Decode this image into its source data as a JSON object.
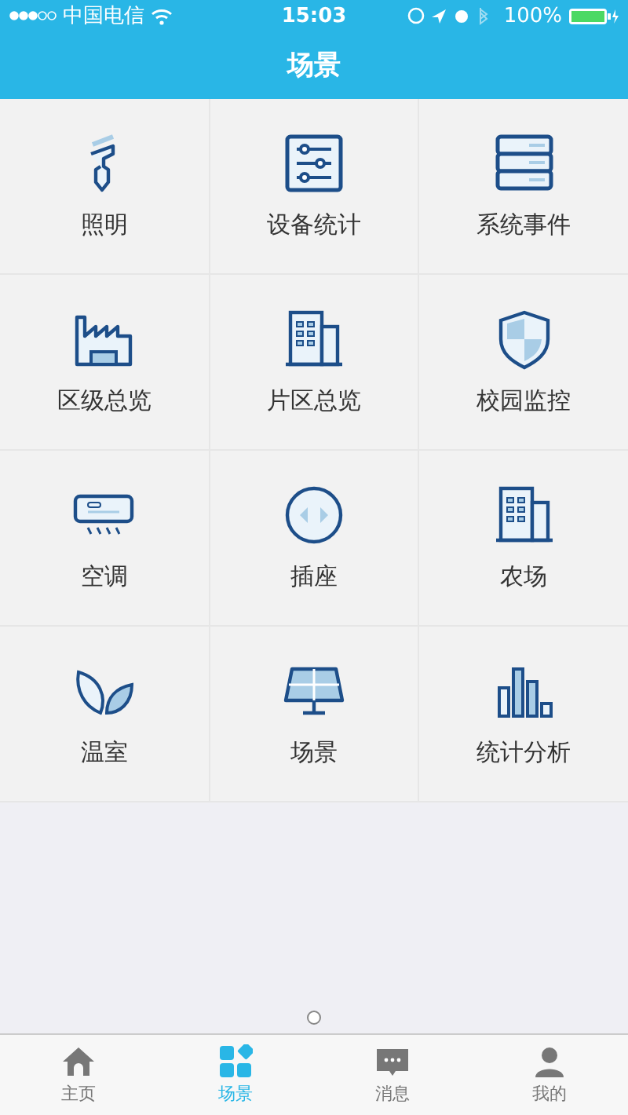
{
  "status_bar": {
    "carrier": "中国电信",
    "time": "15:03",
    "battery": "100%"
  },
  "header": {
    "title": "场景"
  },
  "grid": [
    {
      "label": "照明",
      "kind": "bulb"
    },
    {
      "label": "设备统计",
      "kind": "sliders"
    },
    {
      "label": "系统事件",
      "kind": "server"
    },
    {
      "label": "区级总览",
      "kind": "factory"
    },
    {
      "label": "片区总览",
      "kind": "building"
    },
    {
      "label": "校园监控",
      "kind": "shield"
    },
    {
      "label": "空调",
      "kind": "aircon"
    },
    {
      "label": "插座",
      "kind": "socket"
    },
    {
      "label": "农场",
      "kind": "building"
    },
    {
      "label": "温室",
      "kind": "leaves"
    },
    {
      "label": "场景",
      "kind": "solar"
    },
    {
      "label": "统计分析",
      "kind": "bars"
    }
  ],
  "tab_bar": [
    {
      "label": "主页",
      "kind": "home",
      "selected": false
    },
    {
      "label": "场景",
      "kind": "grid",
      "selected": true
    },
    {
      "label": "消息",
      "kind": "chat",
      "selected": false
    },
    {
      "label": "我的",
      "kind": "user",
      "selected": false
    }
  ]
}
